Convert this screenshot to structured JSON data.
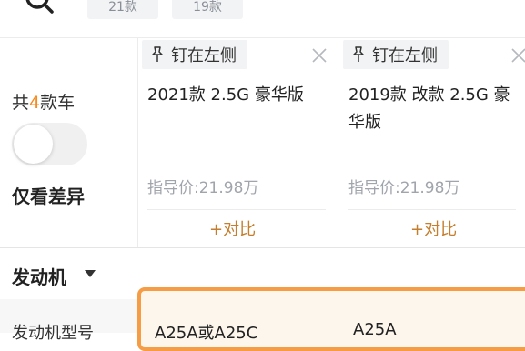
{
  "top_tabs": [
    "21款",
    "19款"
  ],
  "left_panel": {
    "count_prefix": "共",
    "count_number": "4",
    "count_suffix": "款车",
    "diff_toggle_label": "仅看差异"
  },
  "cars": [
    {
      "pin_label": "钉在左侧",
      "name": "2021款 2.5G 豪华版",
      "guide_price": "指导价:21.98万",
      "compare_label": "+对比"
    },
    {
      "pin_label": "钉在左侧",
      "name": "2019款 改款 2.5G 豪华版",
      "guide_price": "指导价:21.98万",
      "compare_label": "+对比"
    }
  ],
  "engine_section": {
    "title": "发动机",
    "row_label": "发动机型号",
    "values": [
      "A25A或A25C",
      "A25A"
    ]
  },
  "colors": {
    "accent_orange": "#f59c45",
    "count_orange": "#f68a1f",
    "compare_text": "#c47e2d"
  }
}
